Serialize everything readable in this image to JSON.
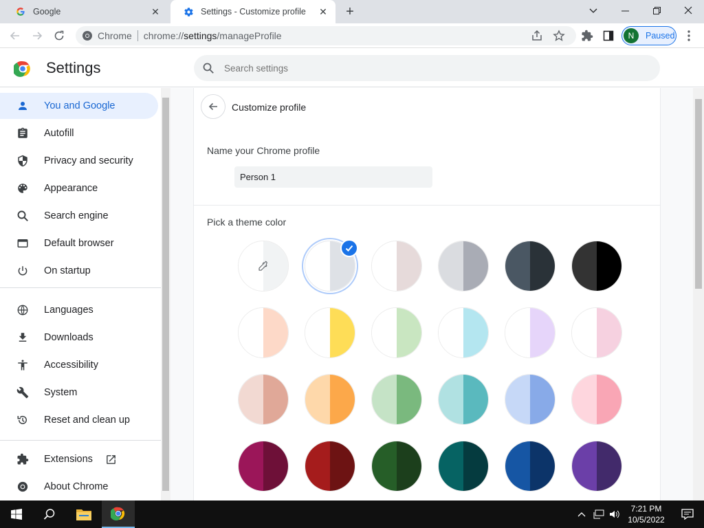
{
  "tabs": [
    {
      "title": "Google",
      "favicon": "google-g-icon"
    },
    {
      "title": "Settings - Customize profile",
      "favicon": "settings-gear-icon"
    }
  ],
  "toolbar": {
    "site_label": "Chrome",
    "url_scheme": "chrome://",
    "url_host": "settings",
    "url_path": "/manageProfile",
    "avatar_letter": "N",
    "profile_status": "Paused"
  },
  "settings": {
    "title": "Settings",
    "search_placeholder": "Search settings"
  },
  "sidebar": {
    "items": [
      {
        "label": "You and Google",
        "icon": "person-icon",
        "selected": true
      },
      {
        "label": "Autofill",
        "icon": "clipboard-icon"
      },
      {
        "label": "Privacy and security",
        "icon": "shield-icon"
      },
      {
        "label": "Appearance",
        "icon": "palette-icon"
      },
      {
        "label": "Search engine",
        "icon": "search-icon"
      },
      {
        "label": "Default browser",
        "icon": "browser-window-icon"
      },
      {
        "label": "On startup",
        "icon": "power-icon"
      },
      {
        "label": "Languages",
        "icon": "globe-icon"
      },
      {
        "label": "Downloads",
        "icon": "download-icon"
      },
      {
        "label": "Accessibility",
        "icon": "accessibility-icon"
      },
      {
        "label": "System",
        "icon": "wrench-icon"
      },
      {
        "label": "Reset and clean up",
        "icon": "history-icon"
      },
      {
        "label": "Extensions",
        "icon": "puzzle-icon"
      },
      {
        "label": "About Chrome",
        "icon": "chrome-icon"
      }
    ]
  },
  "profile": {
    "page_title": "Customize profile",
    "name_label": "Name your Chrome profile",
    "name_value": "Person 1",
    "theme_label": "Pick a theme color",
    "selected_theme": 1,
    "themes": [
      {
        "left": "#ffffff",
        "right": "#f1f3f4",
        "picker": true
      },
      {
        "left": "#ffffff",
        "right": "#dee1e6"
      },
      {
        "left": "#ffffff",
        "right": "#e6dada"
      },
      {
        "left": "#dadce0",
        "right": "#a9acb5"
      },
      {
        "left": "#4a5763",
        "right": "#2a3238"
      },
      {
        "left": "#333333",
        "right": "#000000"
      },
      {
        "left": "#ffffff",
        "right": "#fdd9c8"
      },
      {
        "left": "#ffffff",
        "right": "#fedd57"
      },
      {
        "left": "#ffffff",
        "right": "#c9e6c1"
      },
      {
        "left": "#ffffff",
        "right": "#b4e6f0"
      },
      {
        "left": "#ffffff",
        "right": "#e6d5fa"
      },
      {
        "left": "#ffffff",
        "right": "#f6d1e0"
      },
      {
        "left": "#f2d9d2",
        "right": "#e0a898"
      },
      {
        "left": "#fed8aa",
        "right": "#fca84a"
      },
      {
        "left": "#c5e3c6",
        "right": "#7ab97e"
      },
      {
        "left": "#b0e1e2",
        "right": "#5ab9be"
      },
      {
        "left": "#c6d8f7",
        "right": "#88aae8"
      },
      {
        "left": "#fed6de",
        "right": "#f9a6b5"
      },
      {
        "left": "#9b1659",
        "right": "#6e1038"
      },
      {
        "left": "#a51c1c",
        "right": "#6d1313"
      },
      {
        "left": "#265e28",
        "right": "#1c3f1c"
      },
      {
        "left": "#066363",
        "right": "#053b3f"
      },
      {
        "left": "#1656a4",
        "right": "#0c3469"
      },
      {
        "left": "#6b3fa8",
        "right": "#422a6b"
      }
    ]
  },
  "taskbar": {
    "time": "7:21 PM",
    "date": "10/5/2022"
  }
}
